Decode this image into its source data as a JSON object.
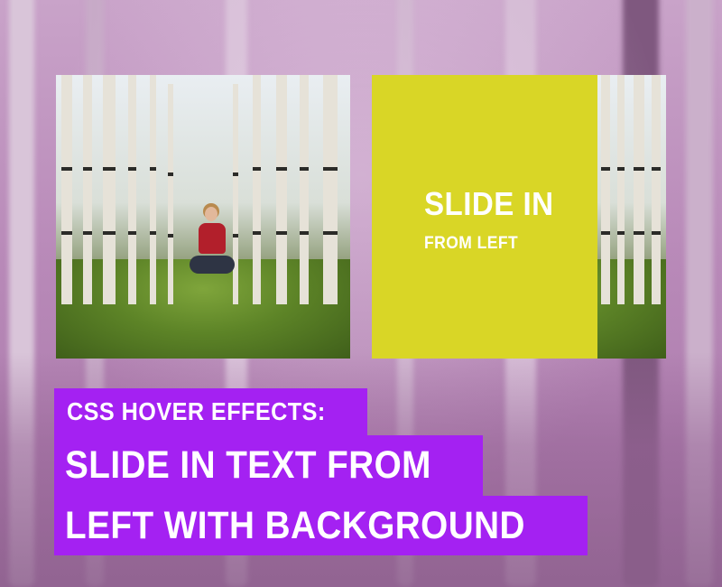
{
  "card": {
    "overlay_title": "SLIDE IN",
    "overlay_subtitle": "FROM LEFT",
    "overlay_color": "#d9d626"
  },
  "headline": {
    "kicker": "CSS HOVER EFFECTS:",
    "line1": "SLIDE IN TEXT FROM",
    "line2": "LEFT WITH BACKGROUND",
    "label_color": "#a421f2"
  },
  "background": {
    "tint": "#b889b8"
  }
}
